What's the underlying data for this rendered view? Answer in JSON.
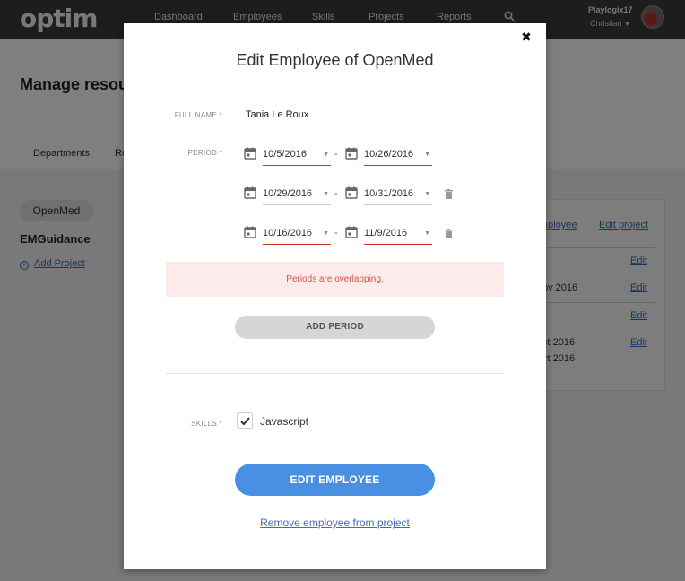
{
  "app": {
    "logo": "optim",
    "nav": [
      "Dashboard",
      "Employees",
      "Skills",
      "Projects",
      "Reports"
    ],
    "search_icon": "search-icon",
    "user": {
      "name": "Playlogix17",
      "role": "Christian"
    }
  },
  "background": {
    "page_title": "Manage resou",
    "tabs": [
      "Departments",
      "Ro"
    ],
    "project_chip": "OpenMed",
    "subproject": "EMGuidance",
    "add_project": "Add Project",
    "card": {
      "links": [
        "nployee",
        "Edit project"
      ],
      "edit_links": [
        "Edit",
        "Edit",
        "Edit",
        "Edit"
      ],
      "texts": [
        "ov 2016",
        "ct 2016",
        "ct 2016"
      ]
    }
  },
  "modal": {
    "title": "Edit Employee of OpenMed",
    "close_icon": "close-icon",
    "full_name_label": "FULL NAME *",
    "full_name_value": "Tania Le Roux",
    "period_label": "PERIOD *",
    "periods": [
      {
        "start": "10/5/2016",
        "end": "10/26/2016",
        "error": true,
        "removable": false
      },
      {
        "start": "10/29/2016",
        "end": "10/31/2016",
        "error": false,
        "removable": true
      },
      {
        "start": "10/16/2016",
        "end": "11/9/2016",
        "error": true,
        "removable": true
      }
    ],
    "error_message": "Periods are overlapping.",
    "add_period_label": "ADD PERIOD",
    "skills_label": "SKILLS *",
    "skills": [
      {
        "name": "Javascript",
        "checked": true
      }
    ],
    "edit_button": "EDIT EMPLOYEE",
    "remove_link": "Remove employee from project",
    "colors": {
      "primary": "#4a90e2",
      "error": "#d9534f",
      "error_bg": "#fdeaea",
      "underline_error": "#c0392b"
    }
  }
}
